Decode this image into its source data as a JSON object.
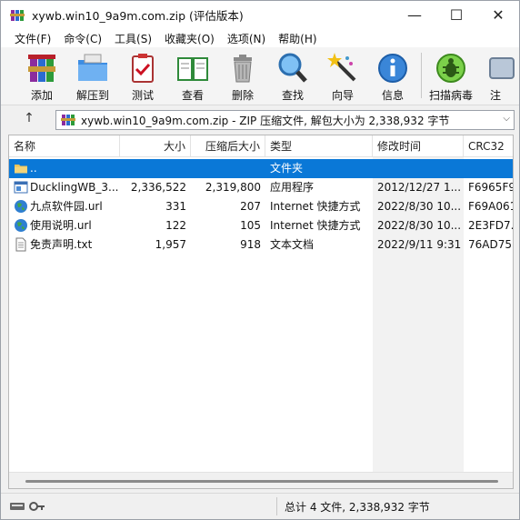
{
  "window": {
    "title": "xywb.win10_9a9m.com.zip (评估版本)",
    "controls": {
      "minimize": "—",
      "maximize": "☐",
      "close": "✕"
    }
  },
  "menu": [
    "文件(F)",
    "命令(C)",
    "工具(S)",
    "收藏夹(O)",
    "选项(N)",
    "帮助(H)"
  ],
  "toolbar": {
    "add": "添加",
    "extract": "解压到",
    "test": "测试",
    "view": "查看",
    "delete": "删除",
    "find": "查找",
    "wizard": "向导",
    "info": "信息",
    "virus_scan": "扫描病毒",
    "comment": "注"
  },
  "address": {
    "up": "↑",
    "text": "xywb.win10_9a9m.com.zip - ZIP 压缩文件, 解包大小为 2,338,932 字节",
    "dropdown": "⌵"
  },
  "columns": {
    "name": "名称",
    "size": "大小",
    "packed": "压缩后大小",
    "type": "类型",
    "modified": "修改时间",
    "crc": "CRC32"
  },
  "rows": [
    {
      "name": "..",
      "size": "",
      "packed": "",
      "type": "文件夹",
      "modified": "",
      "crc": "",
      "icon": "folder-icon"
    },
    {
      "name": "DucklingWB_3...",
      "size": "2,336,522",
      "packed": "2,319,800",
      "type": "应用程序",
      "modified": "2012/12/27 1...",
      "crc": "F6965F9",
      "icon": "application-icon"
    },
    {
      "name": "九点软件园.url",
      "size": "331",
      "packed": "207",
      "type": "Internet 快捷方式",
      "modified": "2022/8/30 10...",
      "crc": "F69A061",
      "icon": "globe-icon"
    },
    {
      "name": "使用说明.url",
      "size": "122",
      "packed": "105",
      "type": "Internet 快捷方式",
      "modified": "2022/8/30 10...",
      "crc": "2E3FD7.",
      "icon": "globe-icon"
    },
    {
      "name": "免责声明.txt",
      "size": "1,957",
      "packed": "918",
      "type": "文本文档",
      "modified": "2022/9/11 9:31",
      "crc": "76AD75",
      "icon": "text-file-icon"
    }
  ],
  "status": {
    "summary": "总计 4 文件, 2,338,932 字节"
  },
  "colors": {
    "selection": "#0a78d7",
    "window_bg": "#f0f0f0"
  }
}
